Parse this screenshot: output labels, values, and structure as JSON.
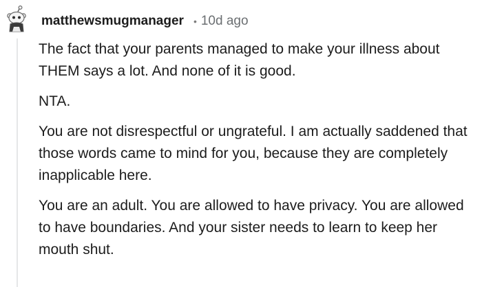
{
  "comment": {
    "author": "matthewsmugmanager",
    "separator": "•",
    "age": "10d ago",
    "paragraphs": [
      "The fact that your parents managed to make your illness about THEM says a lot. And none of it is good.",
      "NTA.",
      "You are not disrespectful or ungrateful. I am actually saddened that those words came to mind for you, because they are completely inapplicable here.",
      "You are an adult. You are allowed to have privacy. You are allowed to have boundaries. And your sister needs to learn to keep her mouth shut."
    ],
    "avatar_icon": "snoo-avatar-icon"
  },
  "colors": {
    "text": "#1c1c1c",
    "meta": "#6b6f72",
    "thread_line": "#e5e7e8"
  }
}
